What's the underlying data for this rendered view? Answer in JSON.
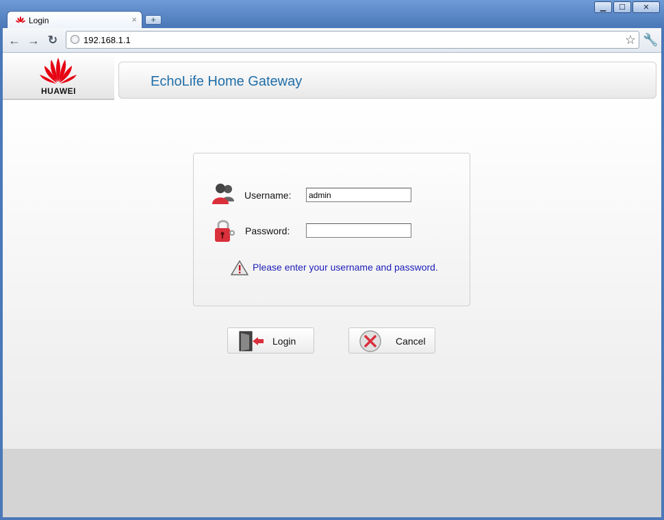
{
  "browser": {
    "tab_title": "Login",
    "url": "192.168.1.1",
    "icons": [
      "back-icon",
      "forward-icon",
      "reload-icon",
      "globe-icon",
      "star-icon",
      "wrench-icon",
      "minimize-icon",
      "maximize-icon",
      "close-icon"
    ]
  },
  "header": {
    "brand": "HUAWEI",
    "title": "EchoLife Home Gateway"
  },
  "login": {
    "username_label": "Username:",
    "username_value": "admin",
    "password_label": "Password:",
    "password_value": "",
    "hint": "Please enter your username and password.",
    "login_button": "Login",
    "cancel_button": "Cancel"
  },
  "colors": {
    "brand_red": "#e60012",
    "title_blue": "#1f6ea8",
    "hint_blue": "#1c1cba"
  }
}
